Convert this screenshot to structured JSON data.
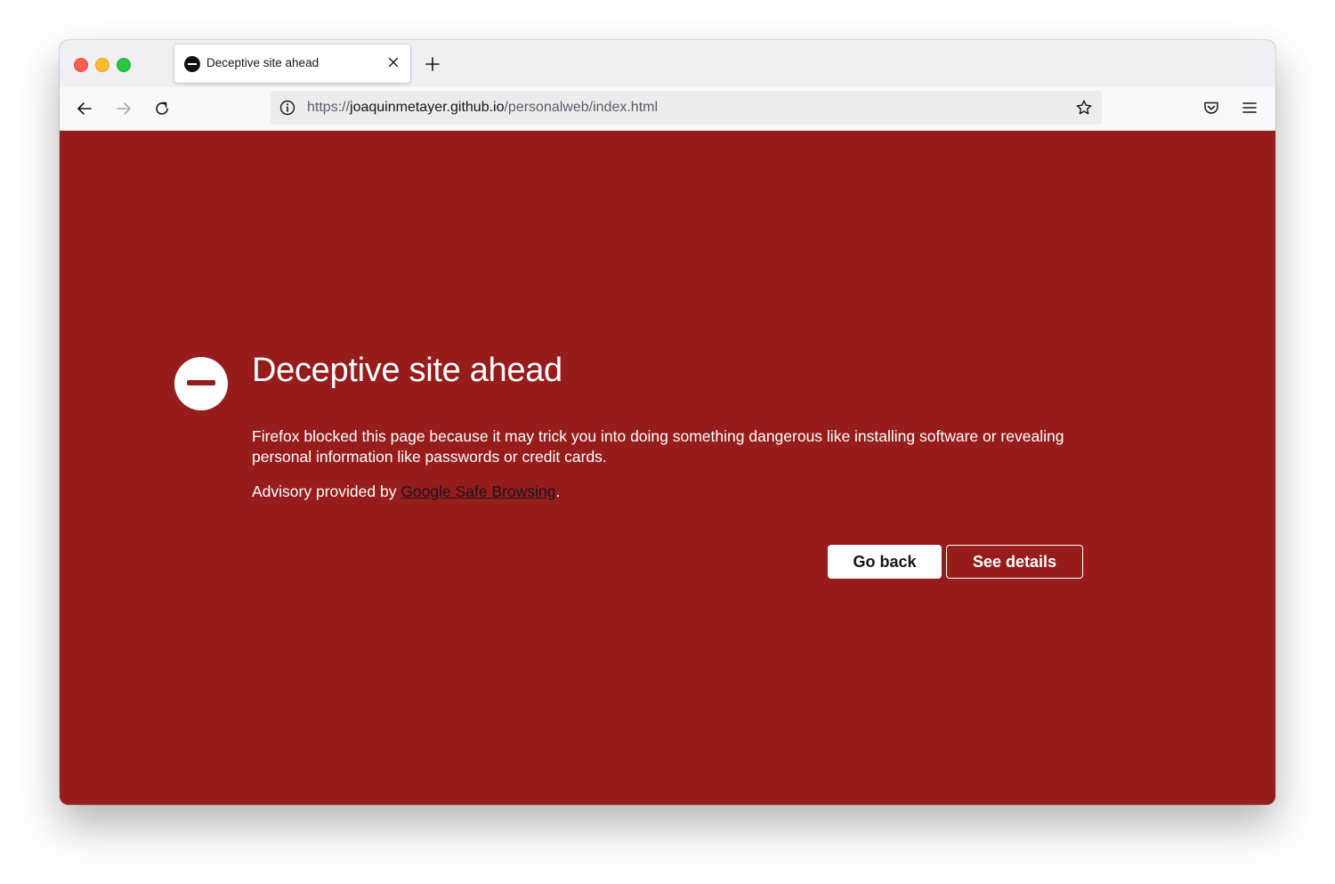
{
  "browser": {
    "tab": {
      "title": "Deceptive site ahead"
    },
    "url": {
      "prefix": "https://",
      "host": "joaquinmetayer.github.io",
      "path": "/personalweb/index.html"
    }
  },
  "page": {
    "heading": "Deceptive site ahead",
    "description": "Firefox blocked this page because it may trick you into doing something dangerous like installing software or revealing personal information like passwords or credit cards.",
    "advisory_prefix": "Advisory provided by ",
    "advisory_link": "Google Safe Browsing",
    "advisory_suffix": ".",
    "go_back_label": "Go back",
    "see_details_label": "See details"
  },
  "colors": {
    "background": "#971c1c",
    "text": "#ffffff"
  },
  "icons": {
    "tab": "blocked-icon",
    "warning": "blocked-icon",
    "info": "info-icon",
    "bookmark": "star-icon",
    "pocket": "pocket-icon",
    "menu": "hamburger-menu-icon"
  }
}
